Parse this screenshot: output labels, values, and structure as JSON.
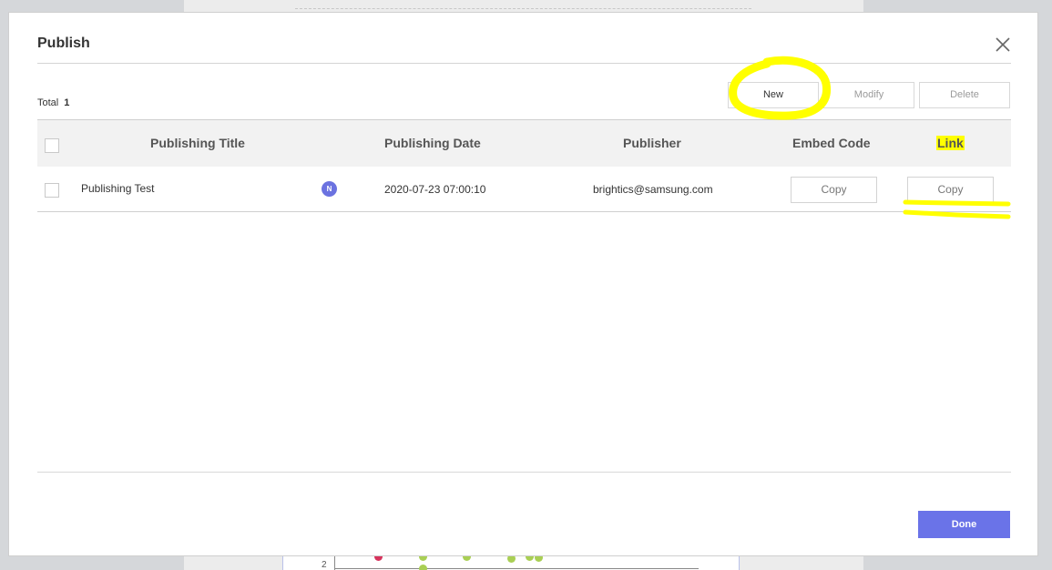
{
  "dialog": {
    "title": "Publish",
    "close_icon": "close-icon",
    "total_label": "Total",
    "total_count": "1"
  },
  "toolbar": {
    "new_label": "New",
    "modify_label": "Modify",
    "delete_label": "Delete"
  },
  "table": {
    "columns": [
      "Publishing Title",
      "Publishing Date",
      "Publisher",
      "Embed Code",
      "Link"
    ],
    "rows": [
      {
        "title": "Publishing Test",
        "badge": "N",
        "date": "2020-07-23 07:00:10",
        "publisher": "brightics@samsung.com",
        "embed_label": "Copy",
        "link_label": "Copy"
      }
    ]
  },
  "footer": {
    "done_label": "Done"
  },
  "background": {
    "chart_tick": "2"
  },
  "colors": {
    "accent": "#6a73e8",
    "badge": "#6b72e0",
    "highlight": "#ffff00"
  }
}
